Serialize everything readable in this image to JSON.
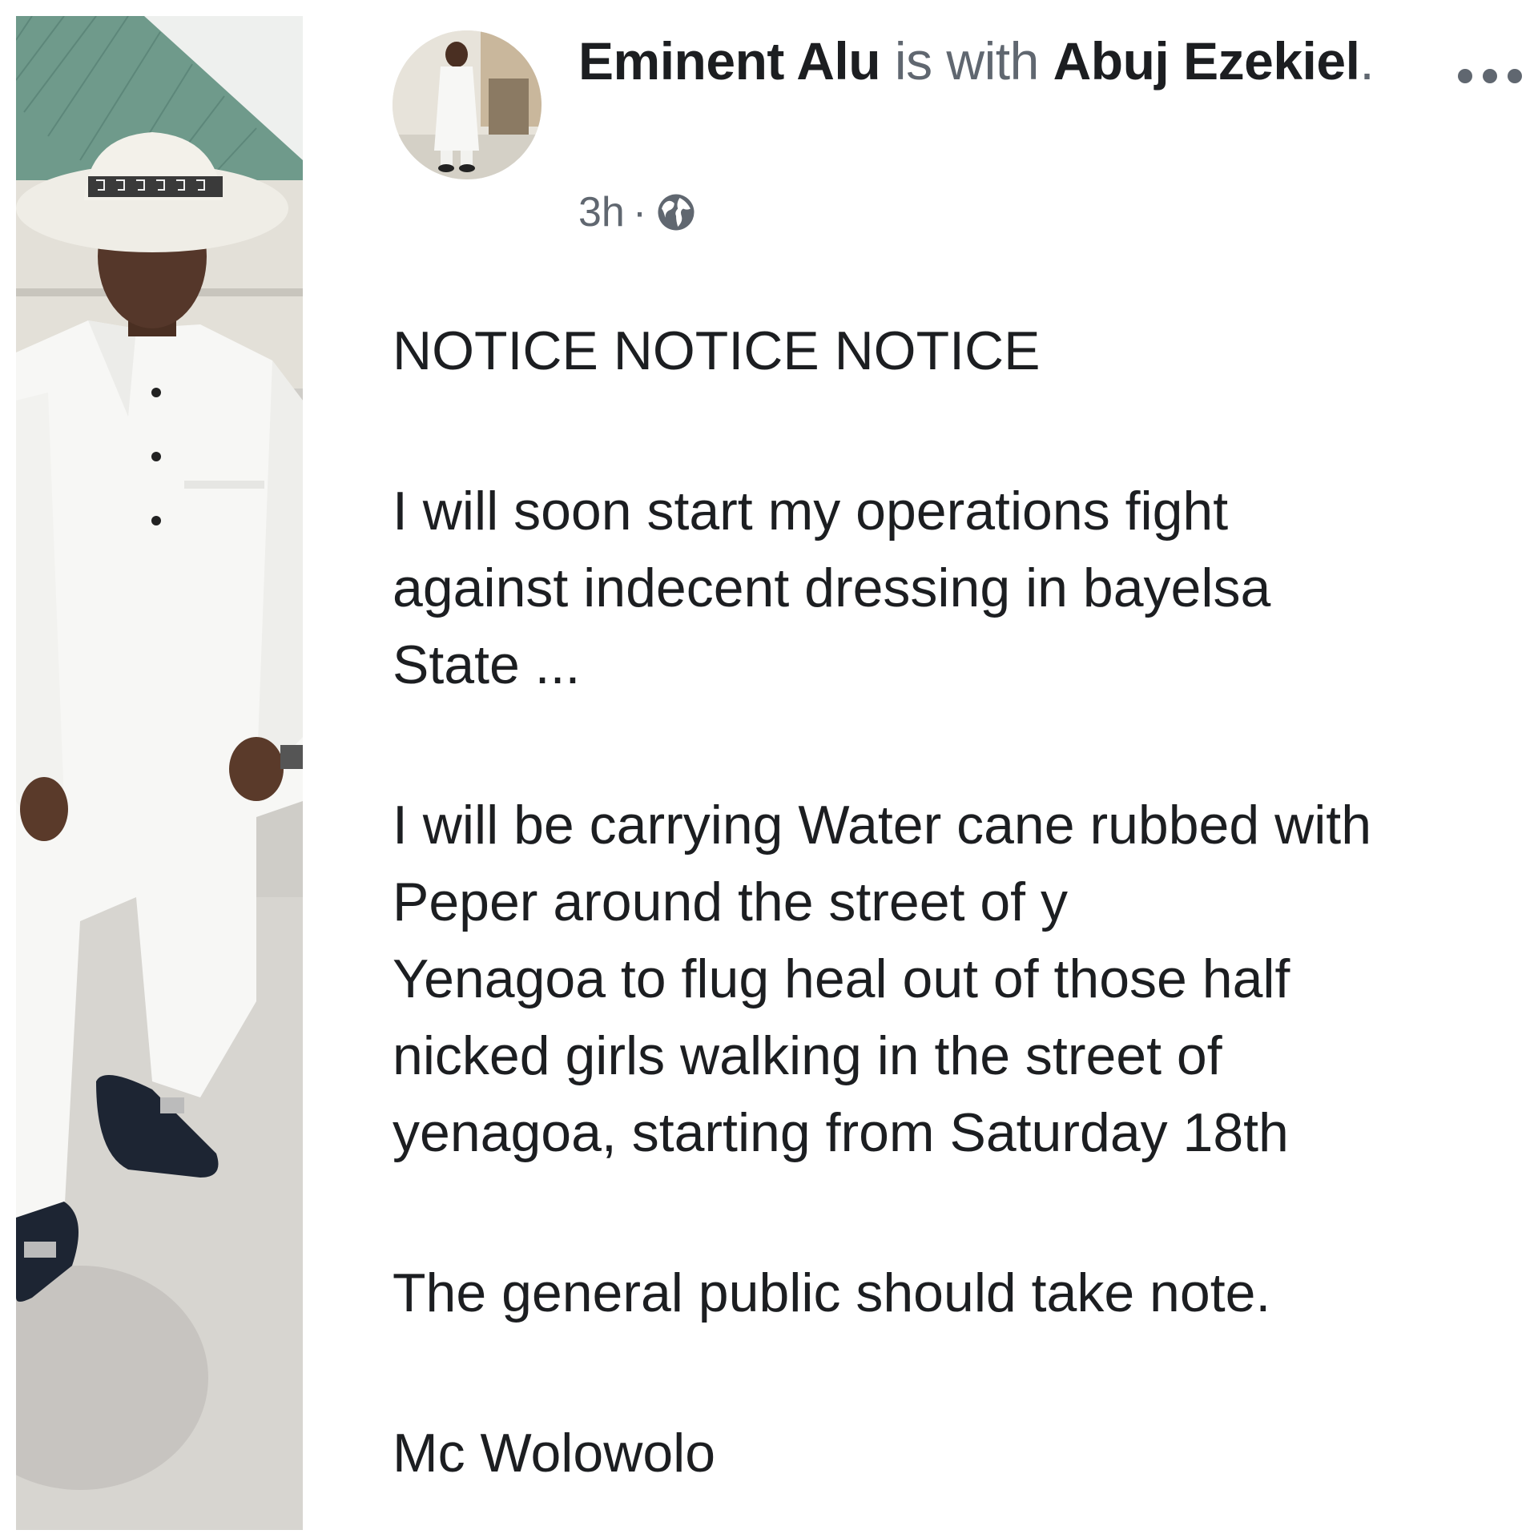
{
  "post": {
    "author": "Eminent Alu",
    "with_text": "is with",
    "tagged": "Abuj Ezekiel",
    "tagged_suffix": ".",
    "time": "3h",
    "separator": "·",
    "privacy_icon": "globe-icon",
    "more_icon": "more-options-icon",
    "body": {
      "heading": "NOTICE NOTICE NOTICE",
      "p1_lines": [
        "I will soon start my operations fight",
        "against indecent dressing in bayelsa",
        "State ..."
      ],
      "p2_lines": [
        "I will be carrying Water cane rubbed with",
        "Peper  around the street of y",
        "Yenagoa to flug heal out of those half",
        "nicked girls walking in the street of",
        "yenagoa, starting from Saturday 18th"
      ],
      "p3": "The general public should take note.",
      "signature": "Mc Wolowolo"
    }
  },
  "colors": {
    "text": "#1c1e21",
    "secondary": "#606770",
    "roof": "#6f9a8b",
    "outfit": "#f7f7f5"
  }
}
